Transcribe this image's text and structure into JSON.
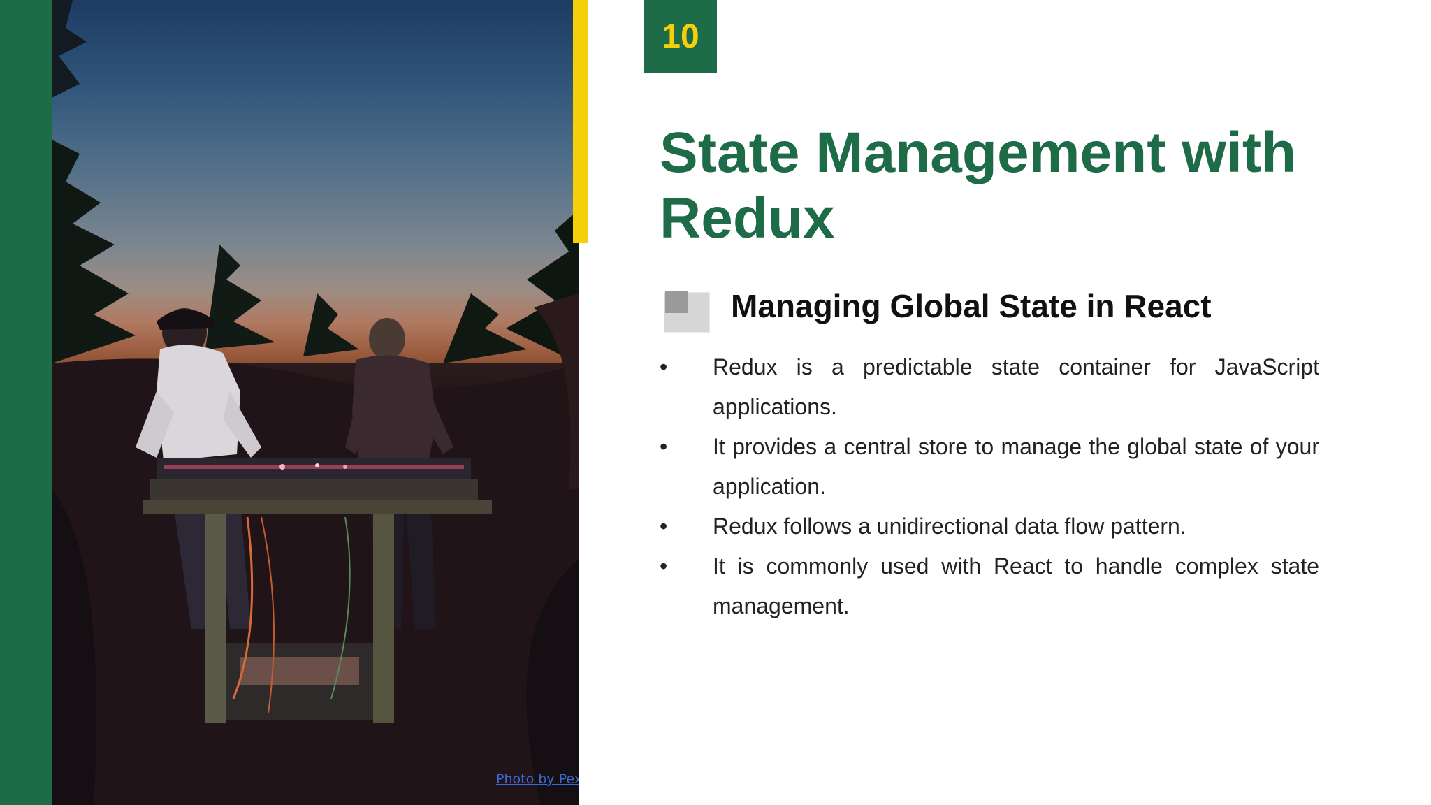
{
  "slide": {
    "number": "10",
    "title": "State Management with Redux",
    "subtitle": "Managing Global State in React",
    "bullets": [
      "Redux is a predictable state container for JavaScript applications.",
      "It provides a central store to manage the global state of your application.",
      "Redux follows a unidirectional data flow pattern.",
      "It is commonly used with React to handle complex state management."
    ],
    "photo_credit": "Photo by Pexels"
  },
  "colors": {
    "brand_green": "#1e6b48",
    "accent_yellow": "#f5d00a",
    "text_dark": "#111111",
    "link_blue": "#3a6ad8"
  },
  "icons": {
    "subtitle_icon": "image-placeholder-icon",
    "bullet_marker": "•"
  }
}
